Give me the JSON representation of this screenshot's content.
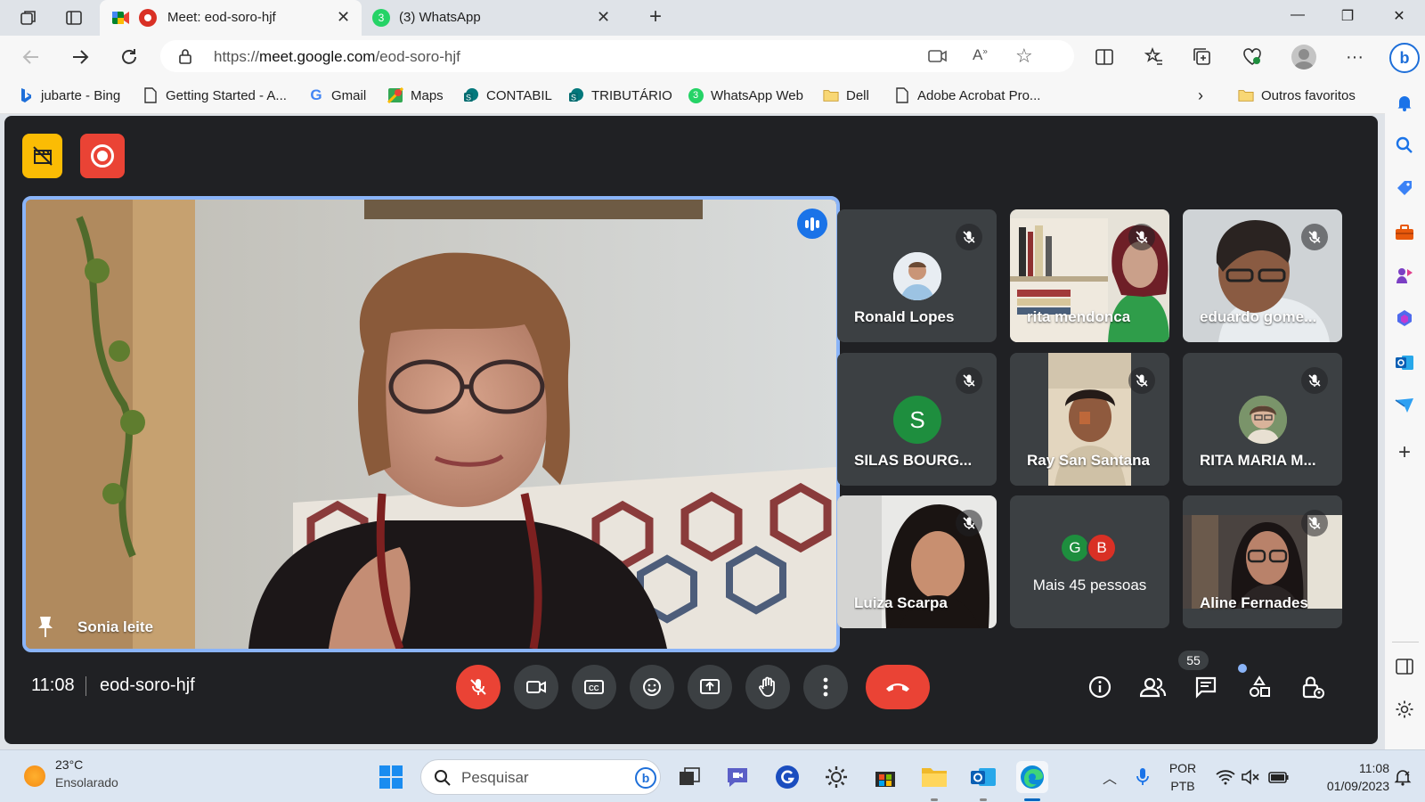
{
  "browser": {
    "tabs": [
      {
        "title": "Meet: eod-soro-hjf",
        "active": true
      },
      {
        "title": "(3) WhatsApp",
        "active": false
      }
    ],
    "address_bar": {
      "url_prefix": "https://",
      "url_host": "meet.google.com",
      "url_path": "/eod-soro-hjf"
    },
    "bookmarks": [
      {
        "label": "jubarte - Bing",
        "icon": "bing-icon"
      },
      {
        "label": "Getting Started - A...",
        "icon": "page-icon"
      },
      {
        "label": "Gmail",
        "icon": "google-icon"
      },
      {
        "label": "Maps",
        "icon": "maps-icon"
      },
      {
        "label": "CONTABIL",
        "icon": "sharepoint-icon"
      },
      {
        "label": "TRIBUTÁRIO",
        "icon": "sharepoint-icon"
      },
      {
        "label": "WhatsApp Web",
        "icon": "whatsapp-icon"
      },
      {
        "label": "Dell",
        "icon": "folder-icon"
      },
      {
        "label": "Adobe Acrobat Pro...",
        "icon": "page-icon"
      }
    ],
    "other_favorites": "Outros favoritos"
  },
  "meet": {
    "main_speaker": {
      "name": "Sonia leite"
    },
    "participants": [
      {
        "name": "Ronald Lopes",
        "kind": "avatar-photo"
      },
      {
        "name": "rita mendonca",
        "kind": "video"
      },
      {
        "name": "eduardo gome...",
        "kind": "video"
      },
      {
        "name": "SILAS BOURG...",
        "kind": "avatar-letter",
        "letter": "S",
        "color": "#1e8e3e"
      },
      {
        "name": "Ray San Santana",
        "kind": "video"
      },
      {
        "name": "RITA MARIA M...",
        "kind": "avatar-photo"
      },
      {
        "name": "Luiza Scarpa",
        "kind": "video"
      },
      {
        "name": "Mais 45 pessoas",
        "kind": "more",
        "letters": [
          "G",
          "B"
        ]
      },
      {
        "name": "Aline Fernades",
        "kind": "video"
      }
    ],
    "time": "11:08",
    "meeting_code": "eod-soro-hjf",
    "participant_count": "55",
    "colors": {
      "background": "#202124",
      "tile": "#3c4043",
      "accent": "#8ab4f8",
      "danger": "#ea4335",
      "badge": "#fbbc04"
    }
  },
  "taskbar": {
    "weather_temp": "23°C",
    "weather_desc": "Ensolarado",
    "search_placeholder": "Pesquisar",
    "lang_top": "POR",
    "lang_bottom": "PTB",
    "clock_time": "11:08",
    "clock_date": "01/09/2023"
  }
}
